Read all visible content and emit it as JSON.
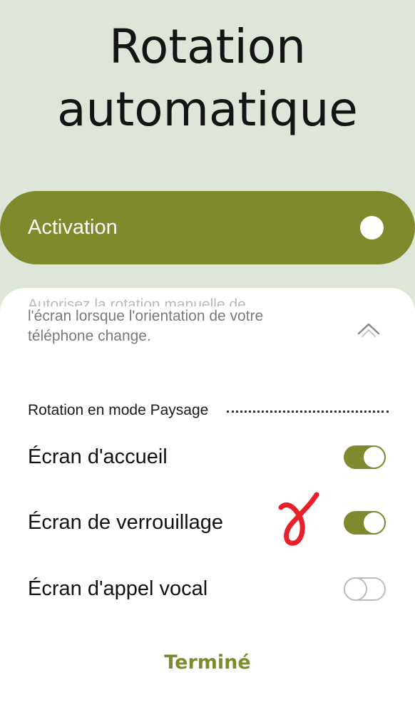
{
  "header": {
    "title_line1": "Rotation",
    "title_line2": "automatique"
  },
  "master": {
    "label": "Activation",
    "state": "on"
  },
  "sheet": {
    "description_partial": "Autorisez la rotation manuelle de",
    "description_line1": "l'écran lorsque l'orientation de votre",
    "description_line2": "téléphone change.",
    "collapse_icon": "chevron-up-icon",
    "section_title": "Rotation en mode Paysage",
    "items": [
      {
        "label": "Écran d'accueil",
        "enabled": true
      },
      {
        "label": "Écran de verrouillage",
        "enabled": true
      },
      {
        "label": "Écran d'appel vocal",
        "enabled": false
      }
    ],
    "done_label": "Terminé"
  },
  "colors": {
    "background": "#dde6d9",
    "accent": "#7f8a2c",
    "annotation": "#e8202a"
  }
}
